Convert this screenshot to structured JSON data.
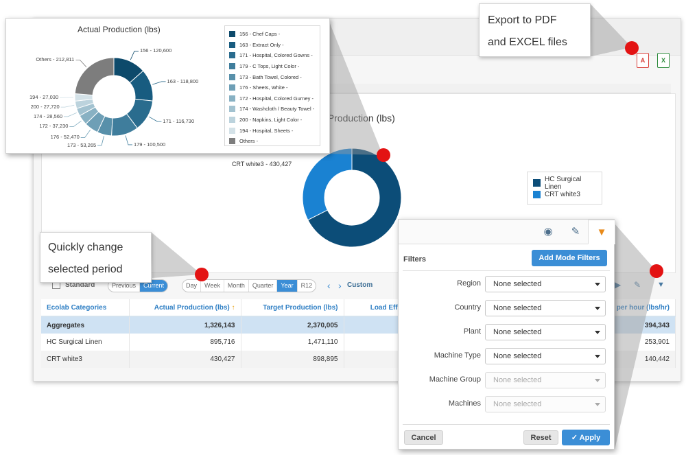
{
  "callouts": {
    "export_line1": "Export to PDF",
    "export_line2": "and EXCEL files",
    "period_line1": "Quickly change",
    "period_line2": "selected period"
  },
  "export": {
    "pdf_icon": "pdf-file-icon",
    "excel_icon": "excel-file-icon",
    "pdf_text": "A",
    "excel_text": "X",
    "pdf_color": "#d9403a",
    "excel_color": "#2e8b3d"
  },
  "popup_chart": {
    "chart_data": {
      "type": "pie",
      "title": "Actual Production (lbs)",
      "categories": [
        "156 - Chef Caps -",
        "163 - Extract Only -",
        "171 - Hospital, Colored Gowns -",
        "179 - C Tops, Light Color -",
        "173 - Bath Towel, Colored -",
        "176 - Sheets, White -",
        "172 - Hospital, Colored Gurney -",
        "174 - Washcloth / Beauty Towel -",
        "200 - Napkins, Light Color -",
        "194 - Hospital, Sheets -",
        "Others -"
      ],
      "values": [
        120600,
        118800,
        116730,
        100500,
        53265,
        52470,
        37230,
        28560,
        27720,
        27030,
        212811
      ],
      "slice_labels": [
        "156 - 120,600",
        "163 - 118,800",
        "171 - 116,730",
        "179 - 100,500",
        "173 - 53,265",
        "176 - 52,470",
        "172 - 37,230",
        "174 - 28,560",
        "200 - 27,720",
        "194 - 27,030",
        "Others - 212,811"
      ],
      "colors": [
        "#0d4a6b",
        "#185c80",
        "#2a6c8e",
        "#3f7d9c",
        "#5890aa",
        "#6e9fb6",
        "#88b1c3",
        "#a2c2d0",
        "#bcd3dd",
        "#d4e2e8",
        "#7d7d7d"
      ],
      "legend_position": "right"
    }
  },
  "main_chart": {
    "title_fragment": "al Production (lbs)",
    "chart_data": {
      "type": "pie",
      "title": "",
      "categories": [
        "HC Surgical Linen",
        "CRT white3"
      ],
      "values": [
        895716,
        430427
      ],
      "slice_labels": [
        "",
        "CRT white3 - 430,427"
      ],
      "colors": [
        "#0c4d78",
        "#1a82d2"
      ],
      "legend_position": "right"
    }
  },
  "toolbar": {
    "standard_label": "Standard",
    "compare": [
      "Previous",
      "Current"
    ],
    "compare_active": "Current",
    "periods": [
      "Day",
      "Week",
      "Month",
      "Quarter",
      "Year",
      "R12"
    ],
    "period_active": "Year",
    "custom_label": "Custom",
    "prev_arrow": "‹",
    "next_arrow": "›"
  },
  "table": {
    "headers": [
      "Ecolab Categories",
      "Actual Production (lbs)",
      "Target Production (lbs)",
      "Load Effi",
      "n per hour (lbs/hr)"
    ],
    "sort_indicator": "↑",
    "rows": [
      [
        "Aggregates",
        "1,326,143",
        "2,370,005",
        "",
        "394,343"
      ],
      [
        "HC Surgical Linen",
        "895,716",
        "1,471,110",
        "",
        "253,901"
      ],
      [
        "CRT white3",
        "430,427",
        "898,895",
        "",
        "140,442"
      ]
    ]
  },
  "filters": {
    "tabs": [
      "view-eye-icon",
      "edit-icon",
      "filter-icon"
    ],
    "title": "Filters",
    "add_button": "Add Mode Filters",
    "fields": [
      {
        "label": "Region",
        "value": "None selected",
        "enabled": true
      },
      {
        "label": "Country",
        "value": "None selected",
        "enabled": true
      },
      {
        "label": "Plant",
        "value": "None selected",
        "enabled": true
      },
      {
        "label": "Machine Type",
        "value": "None selected",
        "enabled": true
      },
      {
        "label": "Machine Group",
        "value": "None selected",
        "enabled": false
      },
      {
        "label": "Machines",
        "value": "None selected",
        "enabled": false
      }
    ],
    "cancel": "Cancel",
    "reset": "Reset",
    "apply": "Apply"
  }
}
